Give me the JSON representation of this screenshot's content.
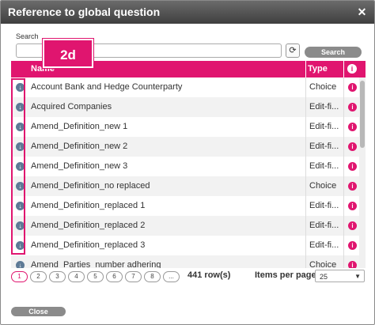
{
  "window": {
    "title": "Reference to global question",
    "close_glyph": "✕"
  },
  "search": {
    "label": "Search",
    "placeholder": "",
    "refresh_glyph": "⟳",
    "button": "Search"
  },
  "callout": {
    "label": "2d"
  },
  "table": {
    "columns": {
      "name": "Name",
      "type": "Type",
      "info_glyph": "i"
    },
    "arrow_glyph": "↓",
    "info_glyph": "i",
    "rows": [
      {
        "name": "Account Bank and Hedge Counterparty",
        "type": "Choice"
      },
      {
        "name": "Acquired Companies",
        "type": "Edit-fi..."
      },
      {
        "name": "Amend_Definition_new 1",
        "type": "Edit-fi..."
      },
      {
        "name": "Amend_Definition_new 2",
        "type": "Edit-fi..."
      },
      {
        "name": "Amend_Definition_new 3",
        "type": "Edit-fi..."
      },
      {
        "name": "Amend_Definition_no replaced",
        "type": "Choice"
      },
      {
        "name": "Amend_Definition_replaced 1",
        "type": "Edit-fi..."
      },
      {
        "name": "Amend_Definition_replaced 2",
        "type": "Edit-fi..."
      },
      {
        "name": "Amend_Definition_replaced 3",
        "type": "Edit-fi..."
      },
      {
        "name": "Amend_Parties_number adhering",
        "type": "Choice"
      }
    ]
  },
  "pager": {
    "pages": [
      "1",
      "2",
      "3",
      "4",
      "5",
      "6",
      "7",
      "8",
      "..."
    ],
    "active_page": "1",
    "rows_count": "441 row(s)",
    "items_per_page_label": "Items per page",
    "items_per_page_value": "25",
    "caret_glyph": "▼"
  },
  "footer": {
    "close_label": "Close"
  },
  "colors": {
    "accent": "#e0156f",
    "arrow": "#5e7a96"
  }
}
